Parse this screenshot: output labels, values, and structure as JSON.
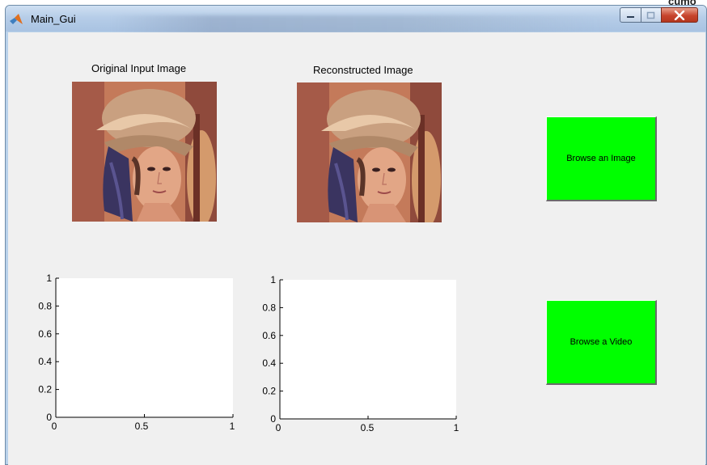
{
  "window": {
    "title": "Main_Gui",
    "corner_text": "cumo",
    "min_label": "–",
    "max_label": "□",
    "close_label": "x"
  },
  "panels": {
    "original_title": "Original Input Image",
    "reconstructed_title": "Reconstructed Image"
  },
  "plot1": {
    "y_ticks": [
      "1",
      "0.8",
      "0.6",
      "0.4",
      "0.2",
      "0"
    ],
    "x_ticks": [
      "0",
      "0.5",
      "1"
    ]
  },
  "plot2": {
    "y_ticks": [
      "1",
      "0.8",
      "0.6",
      "0.4",
      "0.2",
      "0"
    ],
    "x_ticks": [
      "0",
      "0.5",
      "1"
    ]
  },
  "buttons": {
    "browse_image": "Browse an Image",
    "browse_video": "Browse a Video"
  },
  "colors": {
    "button_green": "#00ff00",
    "window_bg": "#f0f0f0",
    "close_red": "#c7442c"
  },
  "icons": {
    "app": "matlab-icon",
    "minimize": "minimize-icon",
    "maximize": "maximize-icon",
    "close": "close-icon"
  }
}
